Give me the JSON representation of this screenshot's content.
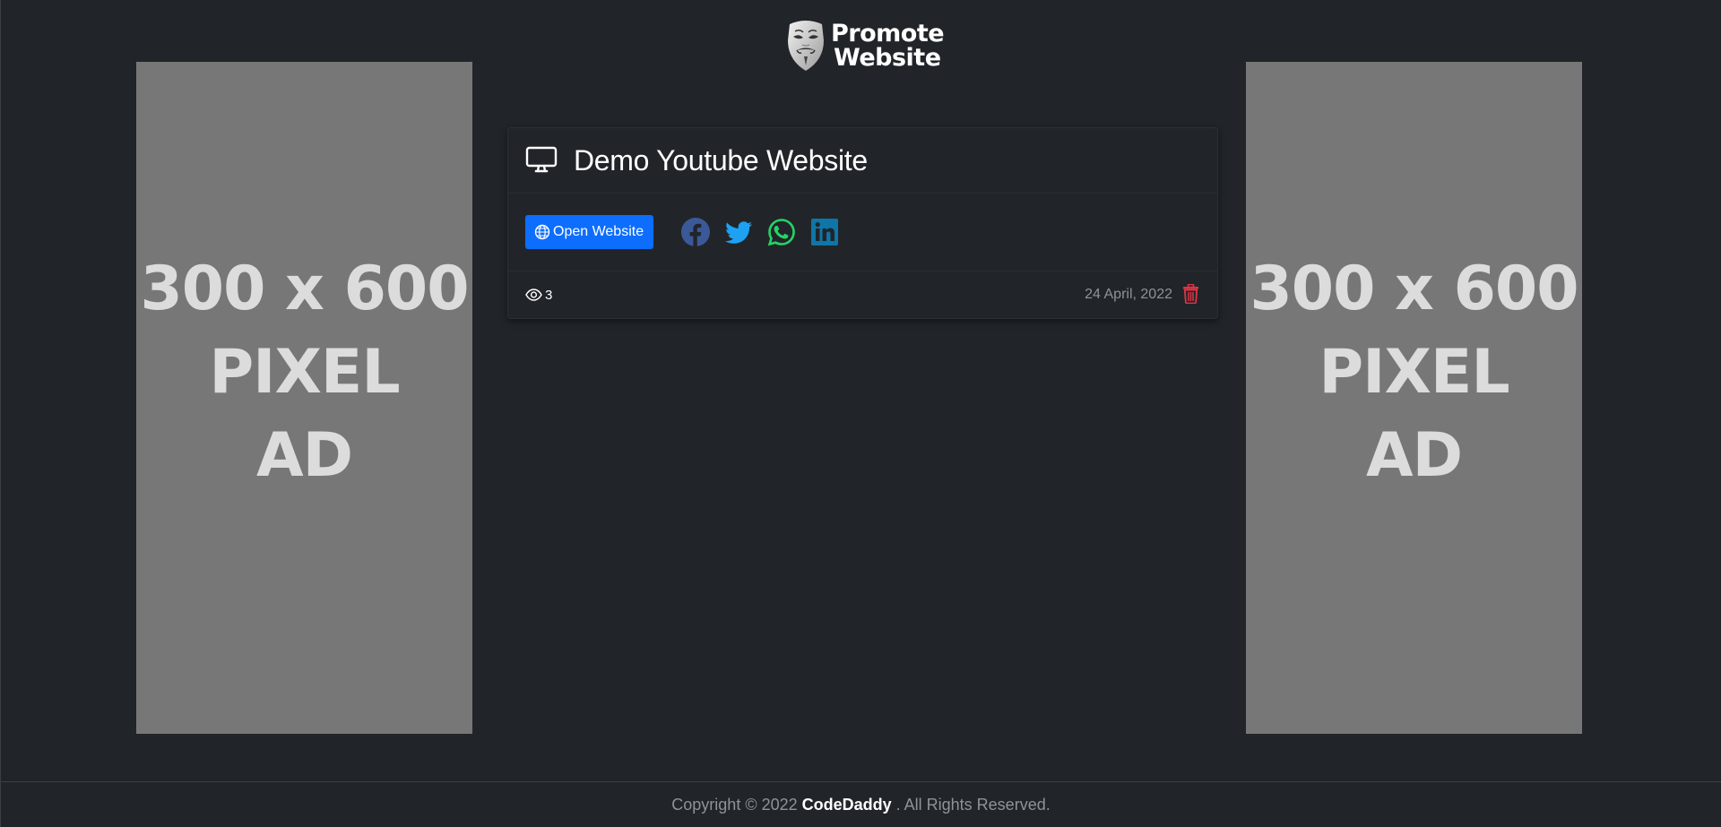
{
  "brand": {
    "logo_line1": "Promote",
    "logo_line2": "Website",
    "logo_icon": "anonymous-mask-icon"
  },
  "ads": {
    "left": {
      "line1": "300 x 600",
      "line2": "PIXEL",
      "line3": "AD"
    },
    "right": {
      "line1": "300 x 600",
      "line2": "PIXEL",
      "line3": "AD"
    }
  },
  "card": {
    "title": "Demo Youtube Website",
    "title_icon": "monitor-icon",
    "open_button_label": "Open Website",
    "share_icons": [
      "facebook-icon",
      "twitter-icon",
      "whatsapp-icon",
      "linkedin-icon"
    ],
    "views": "3",
    "date": "24 April, 2022"
  },
  "footer": {
    "prefix": "Copyright © 2022",
    "brand": "CodeDaddy",
    "suffix": ". All Rights Reserved."
  },
  "colors": {
    "background": "#212529",
    "primary_button": "#0d6efd",
    "facebook": "#3b5998",
    "twitter": "#1da1f2",
    "whatsapp": "#25d366",
    "linkedin": "#0e76a8",
    "delete": "#dc3545",
    "ad_placeholder": "#777777"
  }
}
